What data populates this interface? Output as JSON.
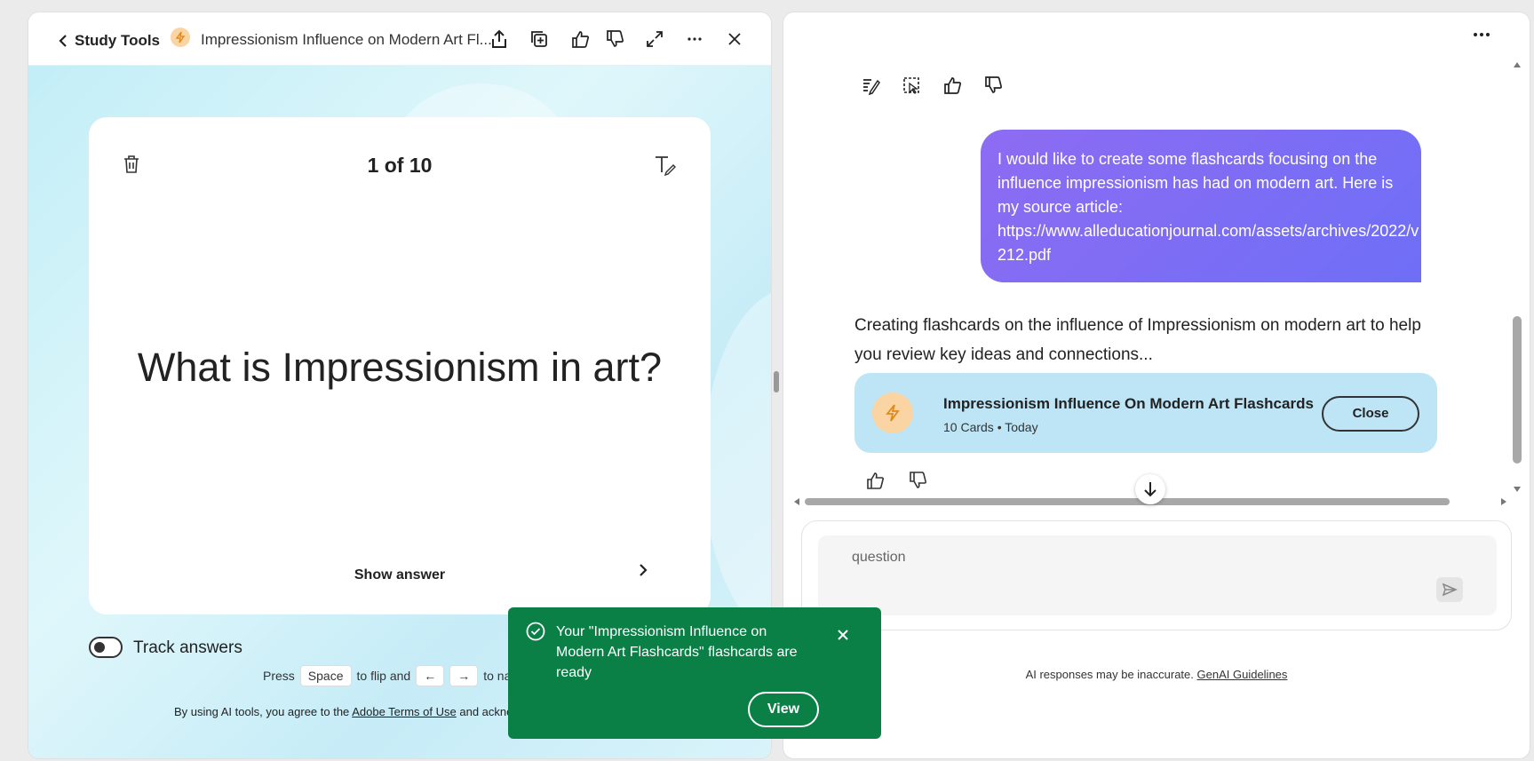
{
  "left_panel": {
    "header": {
      "back_label": "Study Tools",
      "document_title": "Impressionism Influence on Modern Art Fl...",
      "icons": [
        "back-chevron-icon",
        "lightning-icon",
        "share-icon",
        "duplicate-icon",
        "thumbs-up-icon",
        "thumbs-down-icon",
        "expand-icon",
        "more-icon",
        "close-icon"
      ]
    },
    "card": {
      "counter": "1 of 10",
      "question": "What is Impressionism in art?",
      "show_answer_label": "Show answer"
    },
    "track_answers_label": "Track answers",
    "track_answers_on": false,
    "hint": {
      "press": "Press",
      "space_key": "Space",
      "to_flip": "to flip and",
      "left_key": "←",
      "right_key": "→",
      "to_nav": "to nav"
    },
    "terms": {
      "prefix": "By using AI tools, you agree to the",
      "link": "Adobe Terms of Use",
      "suffix": "and acknowl"
    }
  },
  "right_panel": {
    "toolbar_icons": [
      "summary-icon",
      "select-icon",
      "thumbs-up-icon",
      "thumbs-down-icon"
    ],
    "user_message": {
      "line1": "I would like to create some flashcards focusing on the",
      "line2": "influence impressionism has had on modern art. Here is",
      "line3": "my source article:",
      "line4": "https://www.alleducationjournal.com/assets/archives/2022/v",
      "line5": "212.pdf"
    },
    "ai_response": "Creating flashcards on the influence of Impressionism on modern art to help you review key ideas and connections...",
    "flashcard_set": {
      "title": "Impressionism Influence On Modern Art Flashcards",
      "meta": "10 Cards • Today",
      "close_label": "Close"
    },
    "input_placeholder": "question",
    "disclaimer": {
      "text": "AI responses may be inaccurate.",
      "link": "GenAI Guidelines"
    }
  },
  "toast": {
    "message": "Your \"Impressionism Influence on Modern Art Flashcards\" flashcards are ready",
    "view_label": "View",
    "color": "#0a8046"
  },
  "colors": {
    "accent_purple": "#7b6cf5",
    "card_blue": "#bde5f5",
    "badge_orange": "#fbd4a3"
  }
}
